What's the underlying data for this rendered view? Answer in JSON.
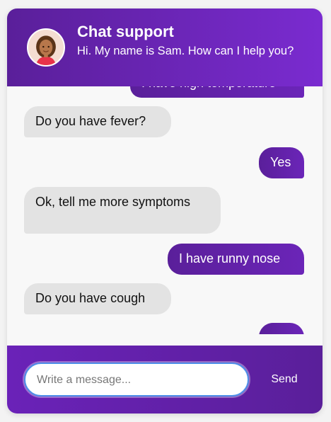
{
  "header": {
    "title": "Chat support",
    "subtitle": "Hi. My name is Sam. How can I help you?"
  },
  "messages": [
    {
      "from": "user",
      "text": "I have high temperature"
    },
    {
      "from": "agent",
      "text": "Do you have fever?"
    },
    {
      "from": "user",
      "text": "Yes"
    },
    {
      "from": "agent",
      "text": "Ok, tell me more symptoms"
    },
    {
      "from": "user",
      "text": "I have runny nose"
    },
    {
      "from": "agent",
      "text": "Do you have cough"
    },
    {
      "from": "user",
      "text": ""
    }
  ],
  "composer": {
    "placeholder": "Write a message...",
    "value": "",
    "send_label": "Send"
  },
  "colors": {
    "brand_purple": "#5a1f9a",
    "brand_purple_light": "#7a2bd0",
    "agent_bubble": "#e3e3e3",
    "input_focus": "#4d8ee8"
  },
  "icons": {
    "avatar": "agent-avatar-woman"
  }
}
